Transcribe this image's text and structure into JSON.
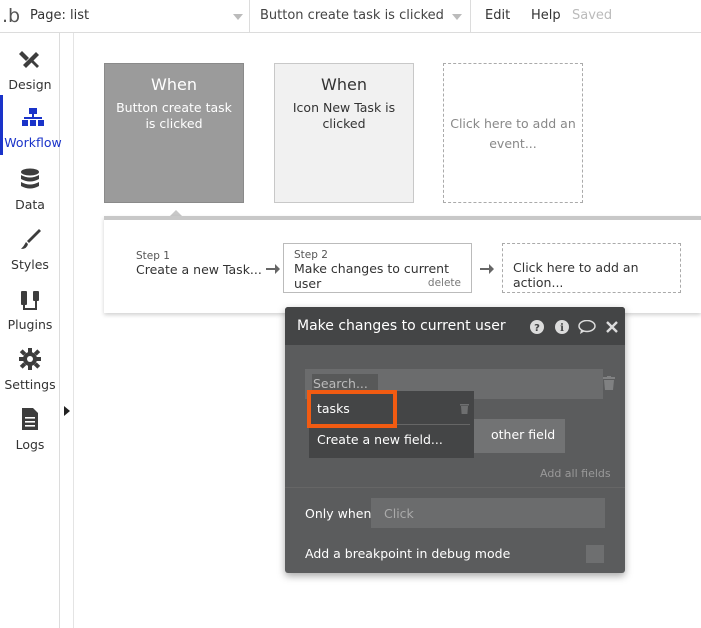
{
  "topbar": {
    "logo": ".b",
    "page_select": "Page: list",
    "event_select": "Button create task is clicked",
    "menu": {
      "edit": "Edit",
      "help": "Help",
      "saved": "Saved"
    }
  },
  "sidebar": {
    "items": [
      {
        "label": "Design",
        "icon": "design-icon"
      },
      {
        "label": "Workflow",
        "icon": "workflow-icon",
        "active": true
      },
      {
        "label": "Data",
        "icon": "data-icon"
      },
      {
        "label": "Styles",
        "icon": "brush-icon"
      },
      {
        "label": "Plugins",
        "icon": "plug-icon"
      },
      {
        "label": "Settings",
        "icon": "gear-icon"
      },
      {
        "label": "Logs",
        "icon": "document-icon"
      }
    ],
    "accent": "#1a33c9"
  },
  "events": [
    {
      "when": "When",
      "desc": "Button create task is clicked"
    },
    {
      "when": "When",
      "desc": "Icon New Task is clicked"
    },
    {
      "placeholder": "Click here to add an event..."
    }
  ],
  "steps": {
    "step1": {
      "num": "Step 1",
      "label": "Create a new Task..."
    },
    "step2": {
      "num": "Step 2",
      "label": "Make changes to current user",
      "delete": "delete"
    },
    "add_action": "Click here to add an action..."
  },
  "panel": {
    "title": "Make changes to current user",
    "header_icons": [
      "help-icon",
      "info-icon",
      "comment-icon",
      "close-icon"
    ],
    "search_placeholder": "Search...",
    "dropdown": {
      "item": "tasks",
      "create": "Create a new field..."
    },
    "other_field": "other field",
    "add_all": "Add all fields",
    "only_when_label": "Only when",
    "only_when_placeholder": "Click",
    "breakpoint_label": "Add a breakpoint in debug mode",
    "highlight_color": "#f25b12"
  }
}
